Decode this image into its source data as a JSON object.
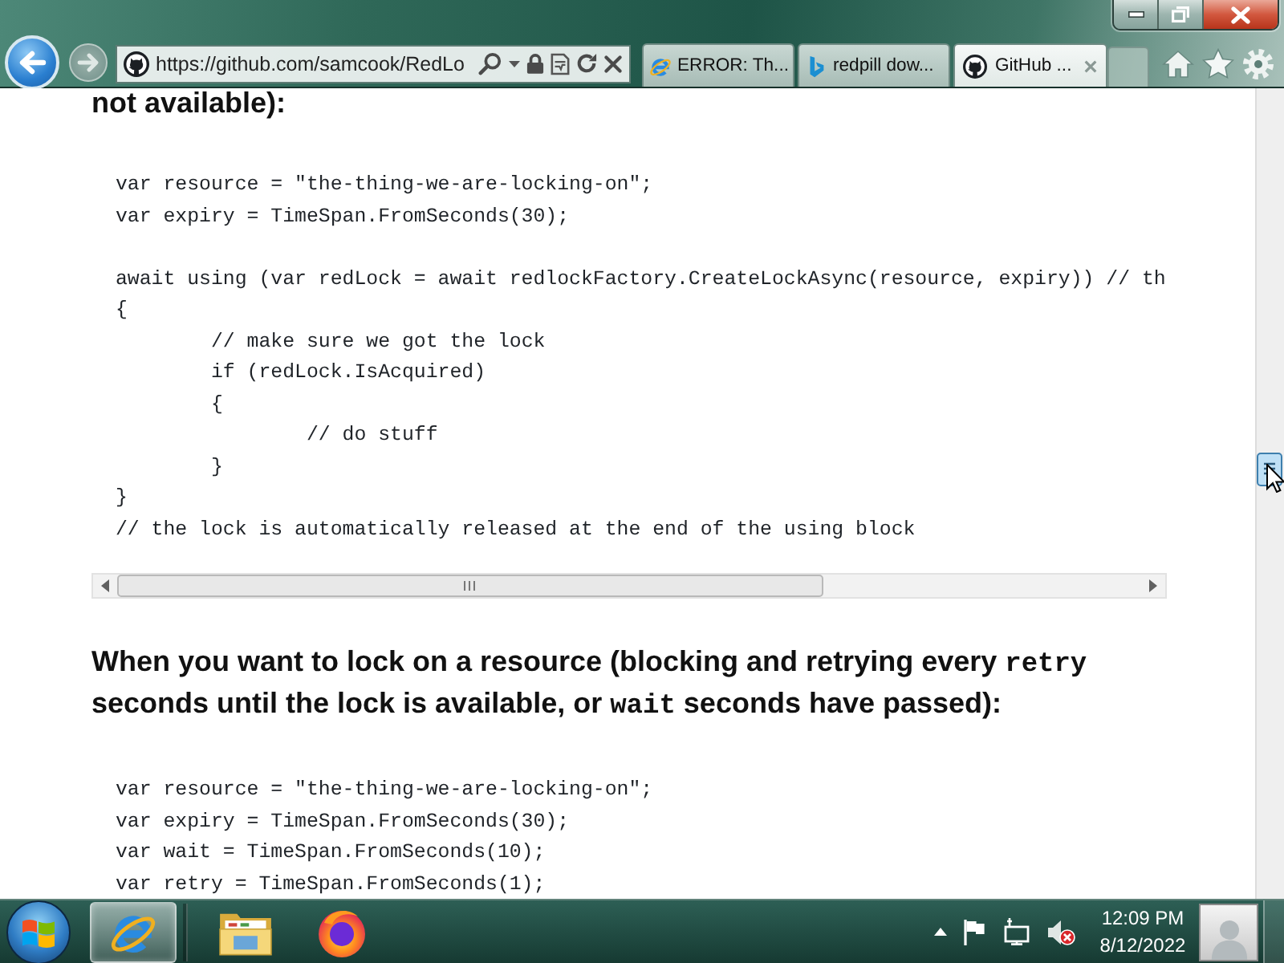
{
  "browser": {
    "back_disabled": false,
    "forward_disabled": true,
    "address": "https://github.com/samcook/RedLo",
    "tabs": [
      {
        "kind": "ie",
        "label": "ERROR: Th...",
        "selected": false
      },
      {
        "kind": "bing",
        "label": "redpill dow...",
        "selected": false
      },
      {
        "kind": "github",
        "label": "GitHub ...",
        "selected": true
      }
    ]
  },
  "page": {
    "blocks": [
      {
        "kind": "heading",
        "text": "not available):"
      },
      {
        "kind": "code",
        "scrollable": true,
        "groups": [
          [
            "var resource = \"the-thing-we-are-locking-on\";",
            "var expiry = TimeSpan.FromSeconds(30);"
          ],
          [
            "await using (var redLock = await redlockFactory.CreateLockAsync(resource, expiry)) // th",
            "{",
            "\t// make sure we got the lock",
            "\tif (redLock.IsAcquired)",
            "\t{",
            "\t\t// do stuff",
            "\t}",
            "}",
            "// the lock is automatically released at the end of the using block"
          ]
        ]
      },
      {
        "kind": "heading",
        "text": "When you want to lock on a resource (blocking and retrying every **retry** seconds until the lock is available, or **wait** seconds have passed):"
      },
      {
        "kind": "code",
        "groups": [
          [
            "var resource = \"the-thing-we-are-locking-on\";",
            "var expiry = TimeSpan.FromSeconds(30);",
            "var wait = TimeSpan.FromSeconds(10);",
            "var retry = TimeSpan.FromSeconds(1);"
          ]
        ]
      }
    ]
  },
  "taskbar": {
    "apps": [
      {
        "kind": "ie",
        "selected": true
      },
      {
        "kind": "folder",
        "selected": false
      },
      {
        "kind": "firefox",
        "selected": false
      }
    ],
    "volume_muted": true,
    "clock": {
      "time": "12:09 PM",
      "date": "8/12/2022"
    }
  }
}
